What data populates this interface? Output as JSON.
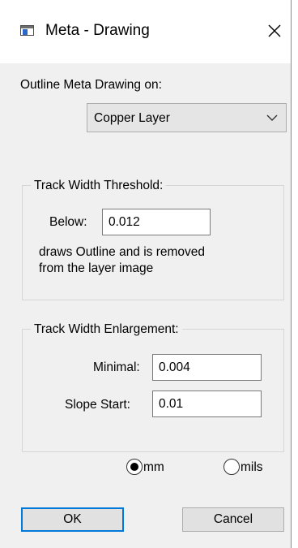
{
  "window": {
    "title": "Meta - Drawing"
  },
  "outline": {
    "label": "Outline Meta Drawing on:",
    "selected": "Copper Layer"
  },
  "threshold": {
    "title": "Track Width Threshold:",
    "below_label": "Below:",
    "below_value": "0.012",
    "description_line1": "draws Outline and is removed",
    "description_line2": "from the layer image"
  },
  "enlargement": {
    "title": "Track Width Enlargement:",
    "minimal_label": "Minimal:",
    "minimal_value": "0.004",
    "slope_label": "Slope Start:",
    "slope_value": "0.01"
  },
  "units": {
    "options": [
      {
        "label": "mm",
        "selected": true
      },
      {
        "label": "mils",
        "selected": false
      }
    ]
  },
  "buttons": {
    "ok": "OK",
    "cancel": "Cancel"
  },
  "icons": {
    "app": "window-app-icon",
    "close": "close-icon",
    "dropdown": "chevron-down-icon"
  }
}
